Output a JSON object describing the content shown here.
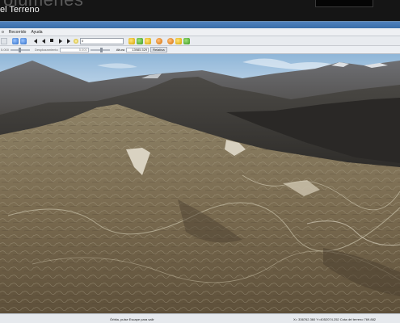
{
  "banner": {
    "ghost_title": "olúmenes",
    "page_title": "el Terreno"
  },
  "menubar": {
    "items": [
      "o",
      "Recorrido",
      "Ayuda"
    ]
  },
  "toolbar": {
    "combo_value": "0"
  },
  "params": {
    "label1": "5.000",
    "label2": "Desplazamiento",
    "field2": "5.000",
    "label3": "Altura",
    "field3": "13985.529",
    "button": "Relativa"
  },
  "status": {
    "left": "Órbita, pulse Escape para salir",
    "right": "X= 336762.360 Y=4052074.252 Cota del terreno 769.882"
  },
  "colors": {
    "sky_top": "#8fb6d8",
    "sky_bottom": "#dbe7f2",
    "terrain": "#7a6b50"
  }
}
